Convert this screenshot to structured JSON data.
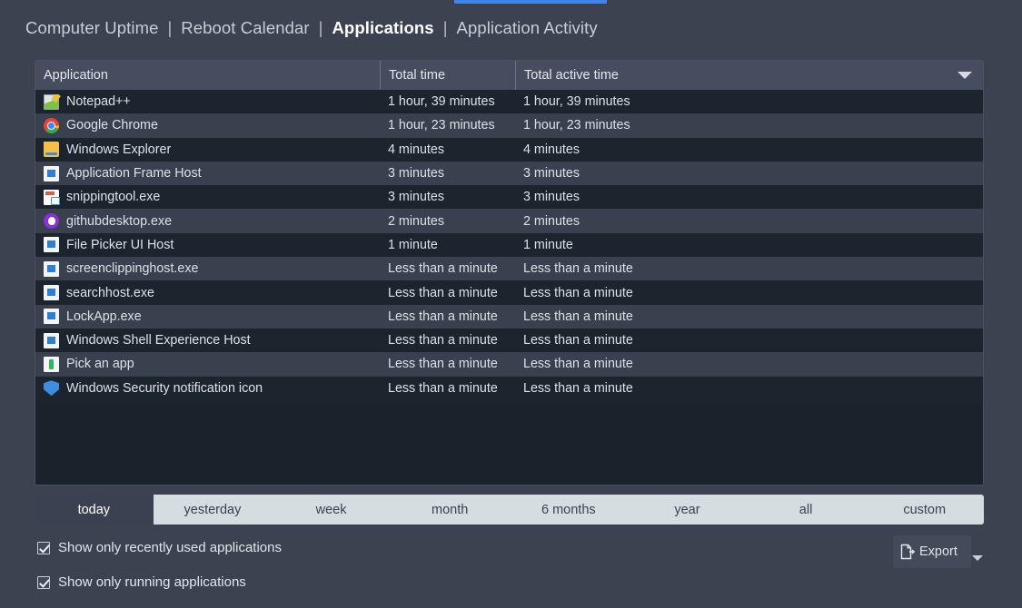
{
  "nav": {
    "items": [
      {
        "label": "Computer Uptime",
        "active": false
      },
      {
        "label": "Reboot Calendar",
        "active": false
      },
      {
        "label": "Applications",
        "active": true
      },
      {
        "label": "Application Activity",
        "active": false
      }
    ],
    "separator": "|"
  },
  "table": {
    "columns": [
      "Application",
      "Total time",
      "Total active time"
    ],
    "sort_indicator": "sort-descending-caret",
    "rows": [
      {
        "icon": "notepadpp-icon",
        "app": "Notepad++",
        "total": "1 hour, 39 minutes",
        "active": "1 hour, 39 minutes"
      },
      {
        "icon": "chrome-icon",
        "app": "Google Chrome",
        "total": "1 hour, 23 minutes",
        "active": "1 hour, 23 minutes"
      },
      {
        "icon": "folder-icon",
        "app": "Windows Explorer",
        "total": "4 minutes",
        "active": "4 minutes"
      },
      {
        "icon": "window-icon",
        "app": "Application Frame Host",
        "total": "3 minutes",
        "active": "3 minutes"
      },
      {
        "icon": "snippingtool-icon",
        "app": "snippingtool.exe",
        "total": "3 minutes",
        "active": "3 minutes"
      },
      {
        "icon": "github-icon",
        "app": "githubdesktop.exe",
        "total": "2 minutes",
        "active": "2 minutes"
      },
      {
        "icon": "window-icon",
        "app": "File Picker UI Host",
        "total": "1 minute",
        "active": "1 minute"
      },
      {
        "icon": "window-icon",
        "app": "screenclippinghost.exe",
        "total": "Less than a minute",
        "active": "Less than a minute"
      },
      {
        "icon": "window-icon",
        "app": "searchhost.exe",
        "total": "Less than a minute",
        "active": "Less than a minute"
      },
      {
        "icon": "window-icon",
        "app": "LockApp.exe",
        "total": "Less than a minute",
        "active": "Less than a minute"
      },
      {
        "icon": "window-icon",
        "app": "Windows Shell Experience Host",
        "total": "Less than a minute",
        "active": "Less than a minute"
      },
      {
        "icon": "pickapp-icon",
        "app": "Pick an app",
        "total": "Less than a minute",
        "active": "Less than a minute"
      },
      {
        "icon": "shield-icon",
        "app": "Windows Security notification icon",
        "total": "Less than a minute",
        "active": "Less than a minute"
      }
    ]
  },
  "range_tabs": {
    "selected": "today",
    "items": [
      "today",
      "yesterday",
      "week",
      "month",
      "6 months",
      "year",
      "all",
      "custom"
    ]
  },
  "options": [
    {
      "label": "Show only recently used applications",
      "checked": true
    },
    {
      "label": "Show only running applications",
      "checked": true
    }
  ],
  "export": {
    "label": "Export",
    "icon": "export-document-icon",
    "dropdown_icon": "caret-down-icon"
  },
  "colors": {
    "background": "#3c4250",
    "accent": "#4285e8",
    "table_header": "#454d5e",
    "row_even": "#1c242e",
    "row_odd": "#39414e",
    "tab_inactive": "#d5dde0",
    "tab_selected": "#3a4150"
  }
}
